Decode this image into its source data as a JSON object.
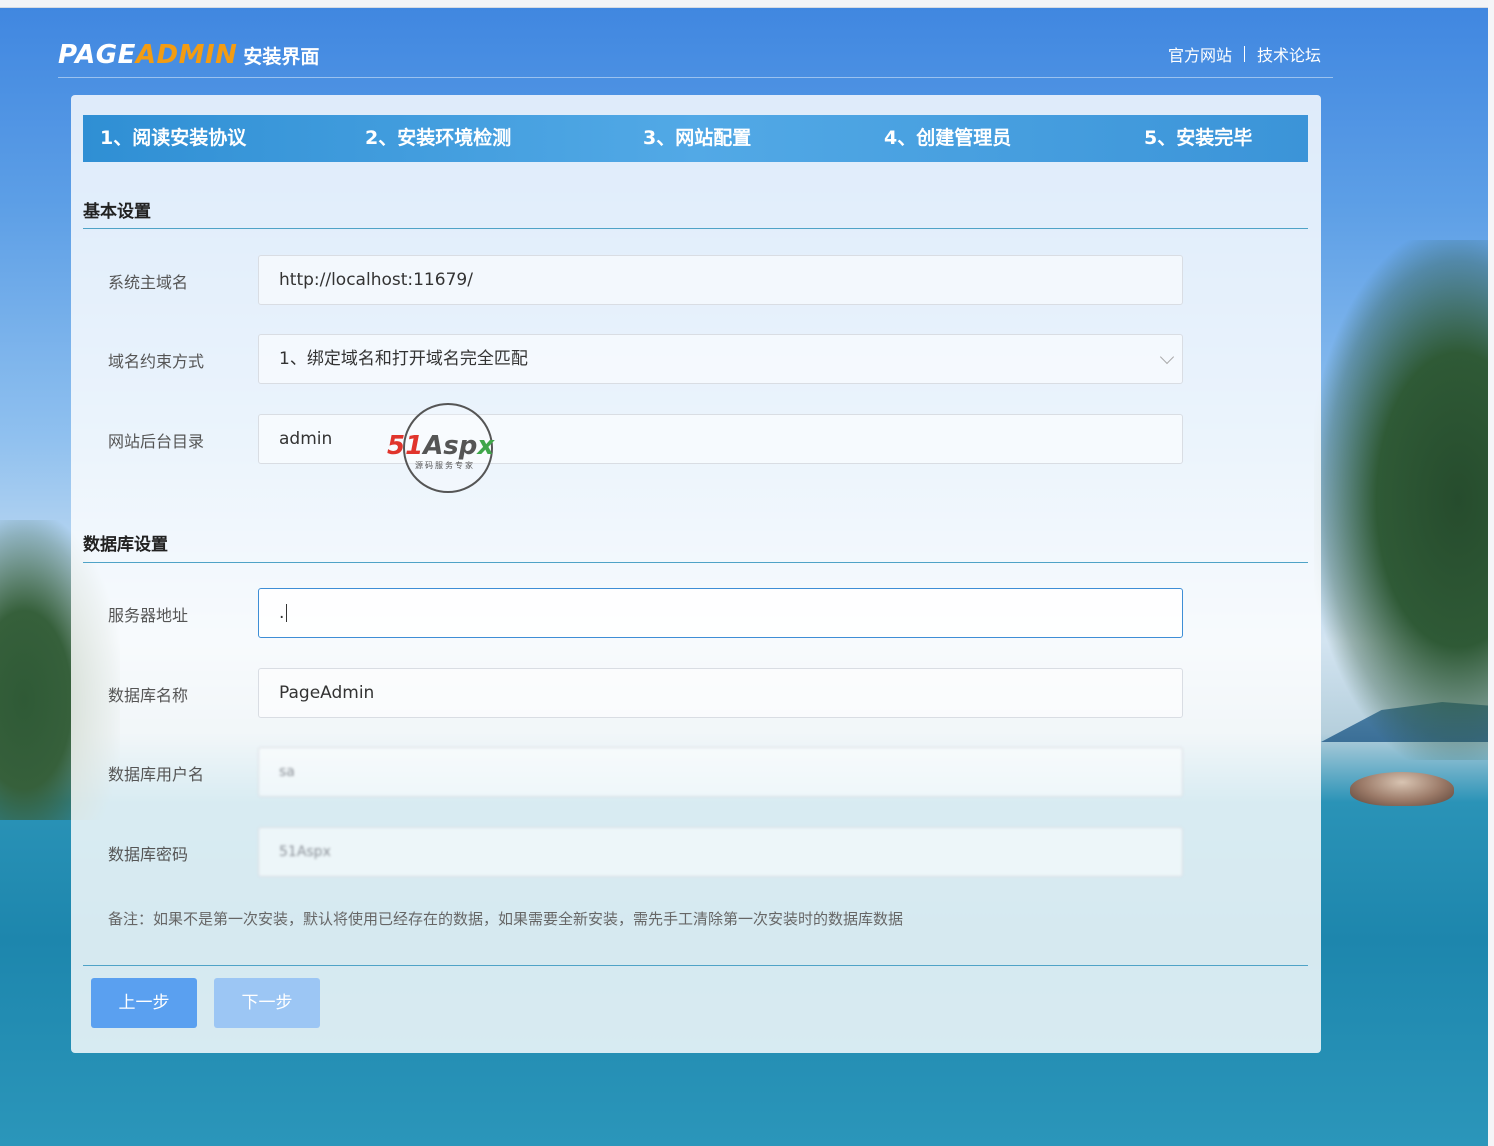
{
  "header": {
    "logo_part1": "PAGE",
    "logo_part2": "ADMIN",
    "logo_sub": "安装界面",
    "links": [
      "官方网站",
      "技术论坛"
    ]
  },
  "steps": [
    "1、阅读安装协议",
    "2、安装环境检测",
    "3、网站配置",
    "4、创建管理员",
    "5、安装完毕"
  ],
  "basic": {
    "title": "基本设置",
    "domain_label": "系统主域名",
    "domain_value": "http://localhost:11679/",
    "constraint_label": "域名约束方式",
    "constraint_value": "1、绑定域名和打开域名完全匹配",
    "admin_dir_label": "网站后台目录",
    "admin_dir_value": "admin"
  },
  "database": {
    "title": "数据库设置",
    "server_label": "服务器地址",
    "server_value": ".",
    "name_label": "数据库名称",
    "name_value": "PageAdmin",
    "user_label": "数据库用户名",
    "user_value": "sa",
    "password_label": "数据库密码",
    "password_value": "51Aspx"
  },
  "note": "备注：如果不是第一次安装，默认将使用已经存在的数据，如果需要全新安装，需先手工清除第一次安装时的数据库数据",
  "buttons": {
    "prev": "上一步",
    "next": "下一步"
  },
  "watermark": {
    "brand1": "51",
    "brand2": "Asp",
    "brand3": "x",
    "sub": "源码服务专家"
  },
  "colors": {
    "accent": "#3b94d8",
    "logo_orange": "#f39c12",
    "button_primary": "#5aa0f0",
    "button_disabled": "#9cc6f4"
  }
}
